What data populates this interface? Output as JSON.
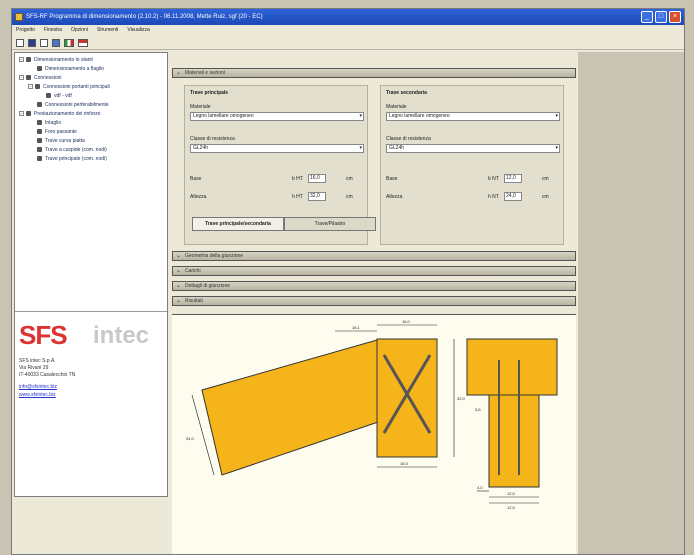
{
  "window": {
    "title": "SFS-RF Programma di dimensionamento (2.10.2) - 06.11.2008, Mette Ruiz, sgf (20 - EC)"
  },
  "window_buttons": [
    "_",
    "□",
    "×"
  ],
  "menu": [
    "Progetto",
    "Finestra",
    "Opzioni",
    "Strumenti",
    "Visualizza"
  ],
  "toolbar": {
    "icons": [
      "new-file-icon",
      "save-icon",
      "print-icon",
      "calc-icon",
      "flag-it-icon",
      "flag-en-icon"
    ]
  },
  "tree": [
    {
      "label": "Dimensionamento lo stanti",
      "level": 0,
      "expander": "−"
    },
    {
      "label": "Dimensionamento a flagilo",
      "level": 2,
      "expander": ""
    },
    {
      "label": "Connessioni",
      "level": 0,
      "expander": "−"
    },
    {
      "label": "Connessioni portanti principali",
      "level": 1,
      "expander": "−"
    },
    {
      "label": "vdf - vdf",
      "level": 3,
      "expander": ""
    },
    {
      "label": "Connessioni perferabilmente",
      "level": 2,
      "expander": ""
    },
    {
      "label": "Prestazionamento dei rinforzo",
      "level": 0,
      "expander": "−"
    },
    {
      "label": "Intaglio",
      "level": 2,
      "expander": ""
    },
    {
      "label": "Foro passante",
      "level": 2,
      "expander": ""
    },
    {
      "label": "Trave curva piatta",
      "level": 2,
      "expander": ""
    },
    {
      "label": "Trave a cuspide (com. nodi)",
      "level": 2,
      "expander": ""
    },
    {
      "label": "Trave principale (com. nodi)",
      "level": 2,
      "expander": ""
    }
  ],
  "logo": {
    "part1": "SFS",
    "part2": "intec"
  },
  "company": {
    "lines": [
      "SFS intec S.p.A.",
      "Via Rivani 29",
      "IT-40033 Casalecchio TN"
    ],
    "links": [
      "info@sfsintec.biz",
      "www.sfsintec.biz"
    ]
  },
  "sections": {
    "top_bar": "Materiali e sezioni",
    "bars": [
      "Geometria della giunzione",
      "Carichi",
      "Dettagli di giunzione",
      "Risultati"
    ]
  },
  "group_left": {
    "title": "Trave principale",
    "material_label": "Materiale",
    "material_value": "Legno lamellare omogeneo",
    "class_label": "Classe di resistenza",
    "class_value": "GL24h",
    "width_label": "Base",
    "width_sym": "b HT",
    "width_value": "16,0",
    "height_label": "Altezza",
    "height_sym": "h HT",
    "height_value": "32,0",
    "unit": "cm"
  },
  "group_right": {
    "title": "Trave secondaria",
    "material_label": "Materiale",
    "material_value": "Legno lamellare omogeneo",
    "class_label": "Classe di resistenza",
    "class_value": "GL24h",
    "width_label": "Base",
    "width_sym": "b NT",
    "width_value": "12,0",
    "height_label": "Altezza",
    "height_sym": "h NT",
    "height_value": "24,0",
    "unit": "cm"
  },
  "tabs": {
    "tab1": "Trave principale/secondaria",
    "tab2": "Trave/Pilastro"
  },
  "drawing": {
    "dims": [
      "16,1",
      "16,0",
      "32,0",
      "16,0",
      "24,0",
      "3,6",
      "4,0",
      "12,0",
      "12,0"
    ]
  },
  "colors": {
    "beam_fill": "#f4b41a",
    "logo_red": "#d33333",
    "title_blue": "#2452c8"
  }
}
